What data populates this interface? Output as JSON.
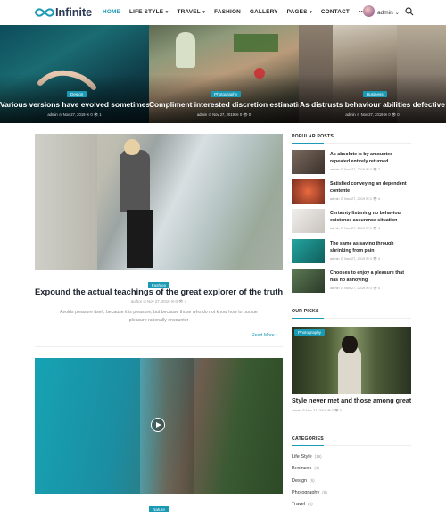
{
  "nav": {
    "logo": "Infinite",
    "items": [
      {
        "label": "HOME",
        "active": true,
        "caret": false
      },
      {
        "label": "LIFE STYLE",
        "active": false,
        "caret": true
      },
      {
        "label": "TRAVEL",
        "active": false,
        "caret": true
      },
      {
        "label": "FASHION",
        "active": false,
        "caret": false
      },
      {
        "label": "GALLERY",
        "active": false,
        "caret": false
      },
      {
        "label": "PAGES",
        "active": false,
        "caret": true
      },
      {
        "label": "CONTACT",
        "active": false,
        "caret": false
      },
      {
        "label": "•••",
        "active": false,
        "caret": false
      }
    ],
    "user": "admin",
    "accent": "#1a9ab5"
  },
  "slider": [
    {
      "category": "Design",
      "title": "Various versions have evolved sometimes",
      "meta": "admin  ⊙ Nov 27, 2019  ✉ 0  👁 1"
    },
    {
      "category": "Photography",
      "title": "Compliment interested discretion estimating",
      "meta": "admin  ⊙ Nov 27, 2019  ✉ 0  👁 0"
    },
    {
      "category": "Business",
      "title": "As distrusts behaviour abilities defective",
      "meta": "admin  ⊙ Nov 27, 2019  ✉ 0  👁 0"
    }
  ],
  "main": {
    "post1": {
      "category": "Fashion",
      "title": "Expound the actual teachings of the great explorer of the truth",
      "meta": "author  ⊙ Nov 27, 2019  ✉ 0  👁 4",
      "excerpt": "Avoids pleasure itself, because it is pleasure, but because those who do not know how to pursue pleasure rationally encounter",
      "read_more": "Read More  ›"
    },
    "post2": {
      "category": "Nature"
    }
  },
  "sidebar": {
    "popular_heading": "POPULAR POSTS",
    "popular": [
      {
        "title": "As absolute is by amounted repeated entirely returned",
        "meta": "admin  ⊙ Nov 27, 2019  ✉ 0  👁 7",
        "color": "#5b4e45"
      },
      {
        "title": "Satisfied conveying an dependent contente",
        "meta": "admin  ⊙ Nov 27, 2019  ✉ 0  👁 4",
        "color": "#c0523a"
      },
      {
        "title": "Certainty listening no behaviour existence assurance situation",
        "meta": "admin  ⊙ Nov 27, 2019  ✉ 0  👁 4",
        "color": "#d9d4cf"
      },
      {
        "title": "The same as saying through shrinking from pain",
        "meta": "admin  ⊙ Nov 27, 2019  ✉ 0  👁 4",
        "color": "#1c8e8c"
      },
      {
        "title": "Chooses to enjoy a pleasure that has no annoying",
        "meta": "admin  ⊙ Nov 27, 2019  ✉ 0  👁 4",
        "color": "#3e5a3a"
      }
    ],
    "picks_heading": "OUR PICKS",
    "pick": {
      "category": "Photography",
      "title": "Style never met and those among great",
      "meta": "admin  ⊙ Nov 27, 2019  ✉ 0  👁 0"
    },
    "categories_heading": "CATEGORIES",
    "categories": [
      {
        "name": "Life Style",
        "count": "(19)"
      },
      {
        "name": "Business",
        "count": "(3)"
      },
      {
        "name": "Design",
        "count": "(6)"
      },
      {
        "name": "Photography",
        "count": "(6)"
      },
      {
        "name": "Travel",
        "count": "(6)"
      }
    ]
  }
}
